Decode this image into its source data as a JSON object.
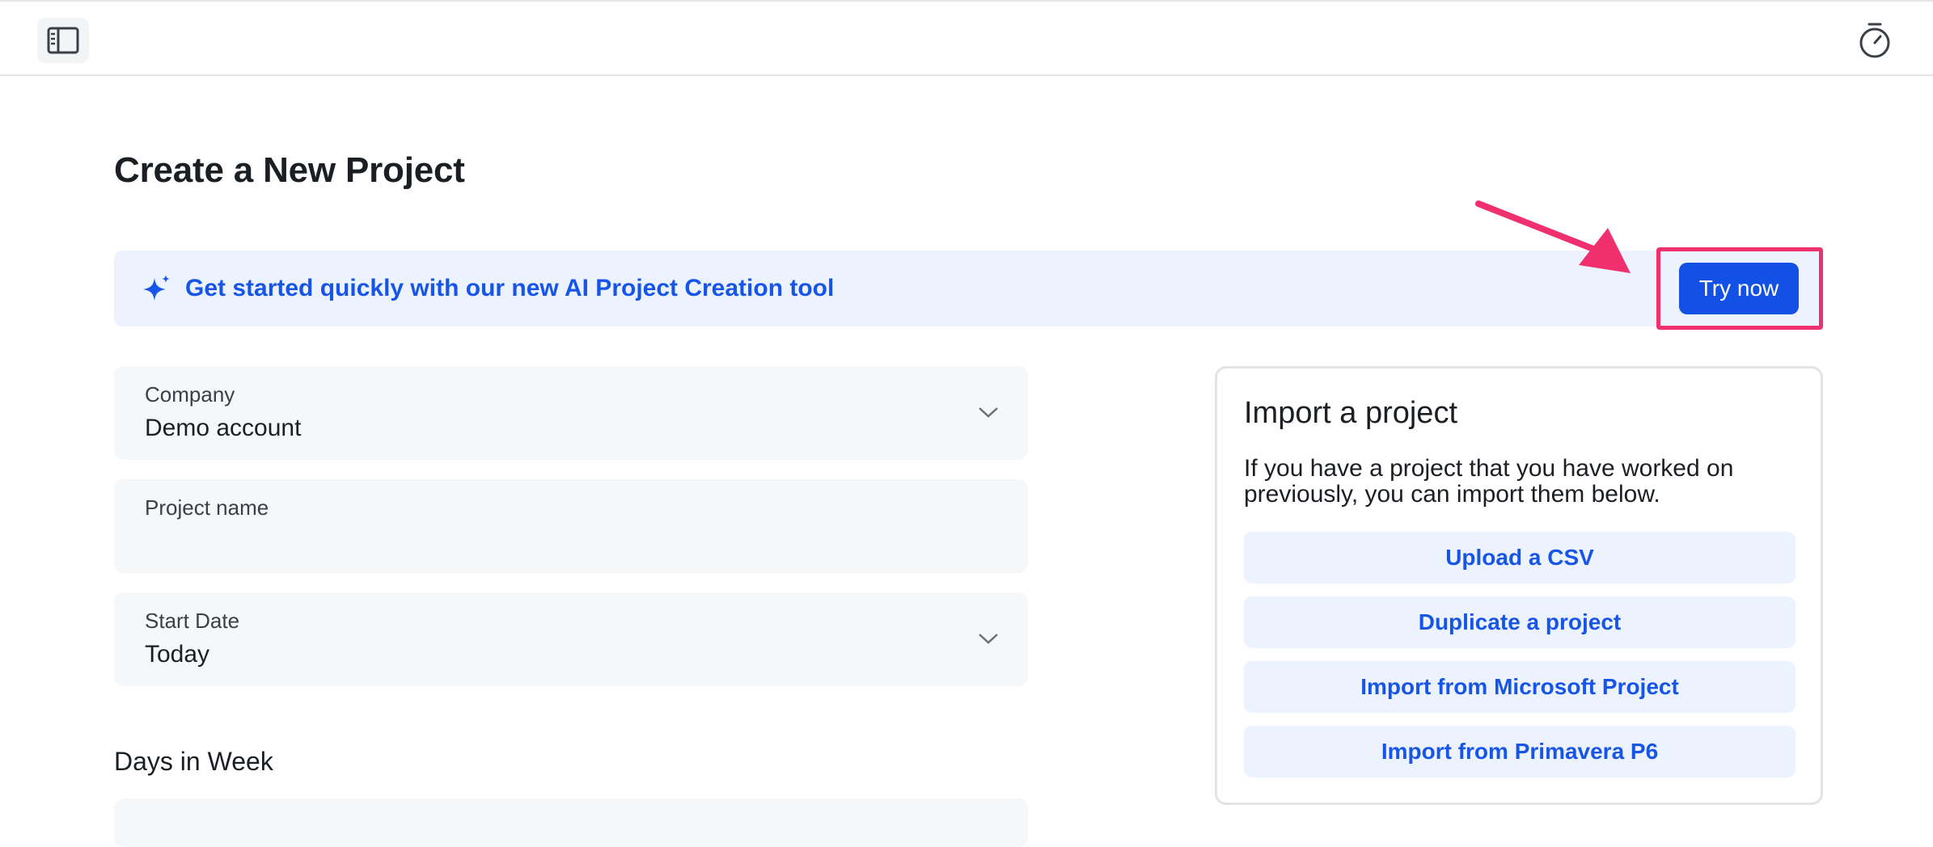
{
  "topbar": {
    "sidebar_toggle_icon": "sidebar-toggle-icon",
    "timer_icon": "stopwatch-icon"
  },
  "page": {
    "title": "Create a New Project"
  },
  "ai_banner": {
    "icon": "sparkle-icon",
    "text": "Get started quickly with our new AI Project Creation tool",
    "button_label": "Try now",
    "accent_color": "#1755e8",
    "highlight_color": "#f0306e"
  },
  "form": {
    "company": {
      "label": "Company",
      "value": "Demo account"
    },
    "project_name": {
      "label": "Project name",
      "value": ""
    },
    "start_date": {
      "label": "Start Date",
      "value": "Today"
    },
    "days_in_week": {
      "label": "Days in Week"
    }
  },
  "import_card": {
    "title": "Import a project",
    "description": "If you have a project that you have worked on previously, you can import them below.",
    "buttons": [
      {
        "label": "Upload a CSV"
      },
      {
        "label": "Duplicate a project"
      },
      {
        "label": "Import from Microsoft Project"
      },
      {
        "label": "Import from Primavera P6"
      }
    ]
  }
}
